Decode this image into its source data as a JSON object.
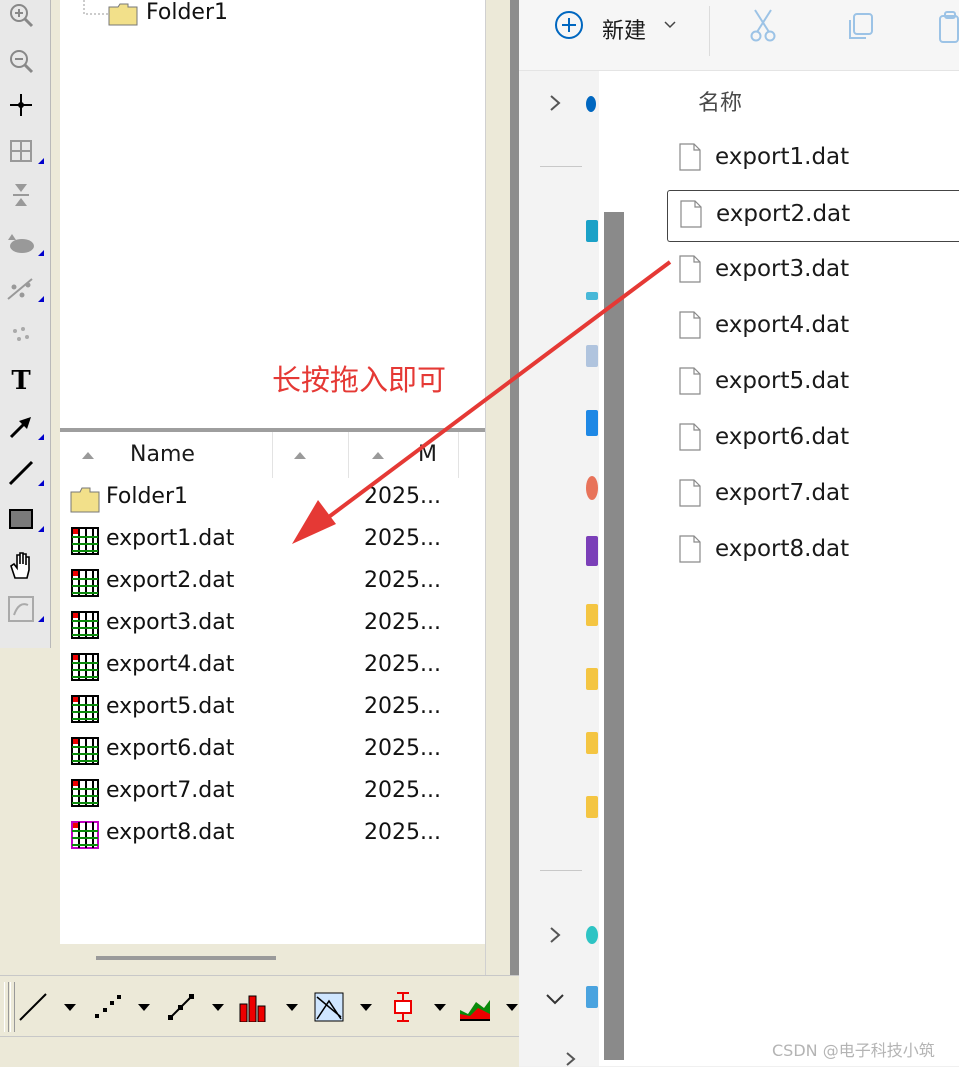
{
  "left_app": {
    "tree": {
      "folder_label": "Folder1"
    },
    "list_header": {
      "name_col": "Name",
      "modified_col": "M"
    },
    "files": [
      {
        "name": "Folder1",
        "date": "2025...",
        "kind": "folder"
      },
      {
        "name": "export1.dat",
        "date": "2025...",
        "kind": "datafile"
      },
      {
        "name": "export2.dat",
        "date": "2025...",
        "kind": "datafile"
      },
      {
        "name": "export3.dat",
        "date": "2025...",
        "kind": "datafile"
      },
      {
        "name": "export4.dat",
        "date": "2025...",
        "kind": "datafile"
      },
      {
        "name": "export5.dat",
        "date": "2025...",
        "kind": "datafile"
      },
      {
        "name": "export6.dat",
        "date": "2025...",
        "kind": "datafile"
      },
      {
        "name": "export7.dat",
        "date": "2025...",
        "kind": "datafile"
      },
      {
        "name": "export8.dat",
        "date": "2025...",
        "kind": "datafile-selected"
      }
    ],
    "tools": [
      "zoom-in-icon",
      "zoom-out-icon",
      "crosshair-icon",
      "grid-icon",
      "arrows-icon",
      "blob-icon",
      "scatter-fit-icon",
      "dots-icon",
      "text-tool-icon",
      "arrow-tool-icon",
      "line-tool-icon",
      "rectangle-tool-icon",
      "hand-tool-icon",
      "function-icon"
    ],
    "text_tool_glyph": "T"
  },
  "annotation": {
    "text": "长按拖入即可",
    "color": "#e53935"
  },
  "explorer": {
    "new_button": "新建",
    "column_name": "名称",
    "files": [
      "export1.dat",
      "export2.dat",
      "export3.dat",
      "export4.dat",
      "export5.dat",
      "export6.dat",
      "export7.dat",
      "export8.dat"
    ],
    "selected_index": 1
  },
  "watermark": "CSDN @电子科技小筑",
  "colors": {
    "accent_blue": "#0067c0",
    "arrow_red": "#e53935",
    "folder_yellow": "#f2e08a"
  }
}
